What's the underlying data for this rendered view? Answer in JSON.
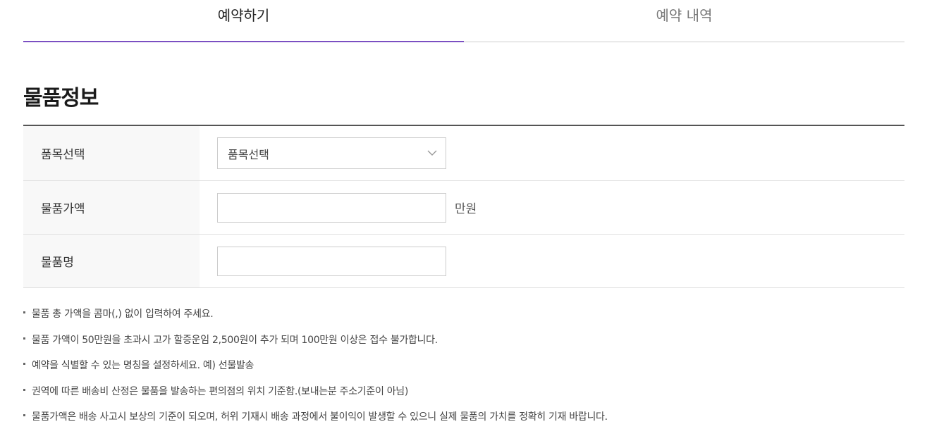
{
  "tabs": [
    {
      "label": "예약하기",
      "active": true
    },
    {
      "label": "예약 내역",
      "active": false
    }
  ],
  "colors": {
    "accent": "#7b4fc2",
    "label_bg": "#f8f8f8",
    "border": "#cccccc"
  },
  "section": {
    "title": "물품정보"
  },
  "form": {
    "category": {
      "label": "품목선택",
      "selected": "품목선택",
      "icon": "chevron-down-icon"
    },
    "price": {
      "label": "물품가액",
      "value": "",
      "unit": "만원"
    },
    "name": {
      "label": "물품명",
      "value": ""
    }
  },
  "notes": [
    "물품 총 가액을 콤마(,) 없이 입력하여 주세요.",
    "물품 가액이 50만원을 초과시 고가 할증운임 2,500원이 추가 되며 100만원 이상은 접수 불가합니다.",
    "예약을 식별할 수 있는 명칭을 설정하세요. 예) 선물발송",
    "권역에 따른 배송비 산정은 물품을 발송하는 편의점의 위치 기준함.(보내는분 주소기준이 아님)",
    "물품가액은 배송 사고시 보상의 기준이 되오며, 허위 기재시 배송 과정에서 불이익이 발생할 수 있으니 실제 물품의 가치를 정확히 기재 바랍니다."
  ]
}
